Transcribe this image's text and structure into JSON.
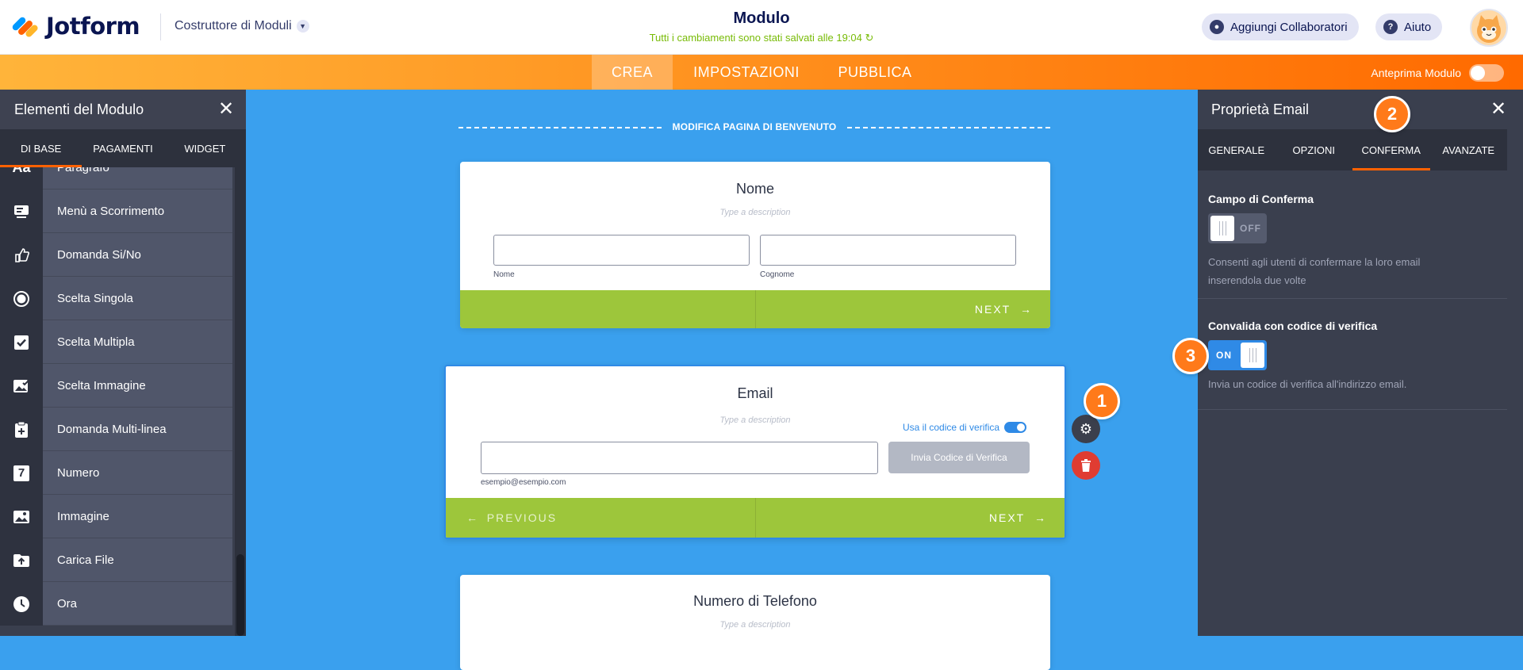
{
  "header": {
    "brand": "Jotform",
    "builder_menu": "Costruttore di Moduli",
    "form_title": "Modulo",
    "save_status": "Tutti i cambiamenti sono stati salvati alle 19:04",
    "add_collaborators": "Aggiungi Collaboratori",
    "help": "Aiuto"
  },
  "nav": {
    "tabs": [
      {
        "label": "CREA",
        "active": true
      },
      {
        "label": "IMPOSTAZIONI",
        "active": false
      },
      {
        "label": "PUBBLICA",
        "active": false
      }
    ],
    "preview_label": "Anteprima Modulo",
    "preview_on": false
  },
  "left_panel": {
    "title": "Elementi del Modulo",
    "tabs": [
      "DI BASE",
      "PAGAMENTI",
      "WIDGET"
    ],
    "active_tab": "DI BASE",
    "items": [
      {
        "icon": "text-icon",
        "label": "Paragrafo"
      },
      {
        "icon": "dropdown-icon",
        "label": "Menù a Scorrimento"
      },
      {
        "icon": "thumb-icon",
        "label": "Domanda Si/No"
      },
      {
        "icon": "radio-icon",
        "label": "Scelta Singola"
      },
      {
        "icon": "checkbox-icon",
        "label": "Scelta Multipla"
      },
      {
        "icon": "image-choice-icon",
        "label": "Scelta Immagine"
      },
      {
        "icon": "multiline-icon",
        "label": "Domanda Multi-linea"
      },
      {
        "icon": "number-icon",
        "label": "Numero"
      },
      {
        "icon": "image-icon",
        "label": "Immagine"
      },
      {
        "icon": "upload-icon",
        "label": "Carica File"
      },
      {
        "icon": "clock-icon",
        "label": "Ora"
      }
    ],
    "glyphs": {
      "text": "Aa",
      "number": "7"
    }
  },
  "canvas": {
    "welcome_link": "MODIFICA PAGINA DI BENVENUTO",
    "name_card": {
      "question": "Nome",
      "description": "Type a description",
      "first_label": "Nome",
      "last_label": "Cognome",
      "next": "NEXT"
    },
    "email_card": {
      "question": "Email",
      "description": "Type a description",
      "verify_toggle_label": "Usa il codice di verifica",
      "verify_on": true,
      "sublabel": "esempio@esempio.com",
      "send_code": "Invia Codice di Verifica",
      "previous": "PREVIOUS",
      "next": "NEXT"
    },
    "phone_card": {
      "question": "Numero di Telefono",
      "description": "Type a description"
    }
  },
  "badges": {
    "one": "1",
    "two": "2",
    "three": "3"
  },
  "right_panel": {
    "title": "Proprietà Email",
    "tabs": [
      "GENERALE",
      "OPZIONI",
      "CONFERMA",
      "AVANZATE"
    ],
    "active_tab": "CONFERMA",
    "sections": [
      {
        "label": "Campo di Conferma",
        "state": "OFF",
        "help": "Consenti agli utenti di confermare la loro email inserendola due volte"
      },
      {
        "label": "Convalida con codice di verifica",
        "state": "ON",
        "help": "Invia un codice di verifica all'indirizzo email."
      }
    ]
  },
  "colors": {
    "orange": "#ff6100",
    "canvas_blue": "#3aa0ee",
    "footer_green": "#9dc63b",
    "save_green": "#78bb07",
    "toggle_blue": "#2f8ae6",
    "delete_red": "#e03c32"
  }
}
